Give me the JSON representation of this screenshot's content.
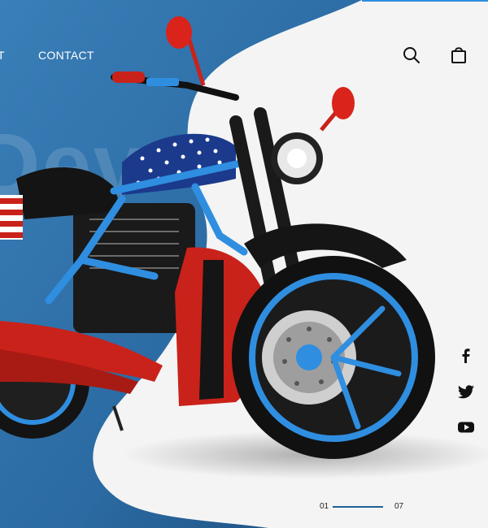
{
  "nav": {
    "partial_item_label": "T",
    "contact_label": "CONTACT"
  },
  "header_icons": {
    "search": "search-icon",
    "cart": "shopping-bag-icon"
  },
  "hero": {
    "background_word": "Dev"
  },
  "social": [
    {
      "name": "facebook-icon",
      "glyph": "f"
    },
    {
      "name": "twitter-icon",
      "glyph": "twitter"
    },
    {
      "name": "youtube-icon",
      "glyph": "youtube"
    }
  ],
  "slider": {
    "current": "01",
    "total": "07",
    "progress": 1.0
  },
  "colors": {
    "panel_blue": "#2e6da4",
    "panel_blue_dark": "#1d4f7c",
    "accent_blue": "#2f8ee0",
    "bike_red": "#c9221a",
    "page_bg": "#f4f4f4"
  }
}
